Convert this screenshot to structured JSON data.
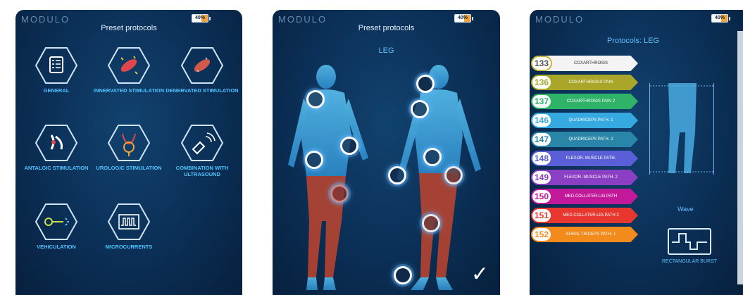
{
  "screens": [
    {
      "logo": "MODULO",
      "battery": "40%",
      "title": "Preset protocols",
      "protocols": [
        {
          "label": "GENERAL",
          "icon": "checklist-icon"
        },
        {
          "label": "INNERVATED STIMULATION",
          "icon": "innervated-muscle-icon"
        },
        {
          "label": "DENERVATED STIMULATION",
          "icon": "denervated-muscle-icon"
        },
        {
          "label": "ANTALGIC STIMULATION",
          "icon": "antalgic-joint-icon"
        },
        {
          "label": "UROLOGIC STIMULATION",
          "icon": "urologic-icon"
        },
        {
          "label": "COMBINATION WITH ULTRASOUND",
          "icon": "ultrasound-probe-icon"
        },
        {
          "label": "VEHICULATION",
          "icon": "vehiculation-icon"
        },
        {
          "label": "MICROCURRENTS",
          "icon": "microcurrent-wave-icon"
        }
      ]
    },
    {
      "logo": "MODULO",
      "battery": "40%",
      "title": "Preset protocols",
      "region": "LEG"
    },
    {
      "logo": "MODULO",
      "battery": "40%",
      "title": "Protocols: LEG",
      "items": [
        {
          "num": "133",
          "label": "COXARTHROSIS",
          "color": "#f4f4f4",
          "text": "#333"
        },
        {
          "num": "136",
          "label": "COXARTHROSIS PAIN",
          "color": "#a9a62a",
          "text": "#fff"
        },
        {
          "num": "137",
          "label": "COXARTHROSIS PAIN 2",
          "color": "#2fb368",
          "text": "#fff"
        },
        {
          "num": "146",
          "label": "QUADRICEPS PATH. 1",
          "color": "#36a9e0",
          "text": "#fff"
        },
        {
          "num": "147",
          "label": "QUADRICEPS PATH. 2",
          "color": "#2a86a8",
          "text": "#fff"
        },
        {
          "num": "148",
          "label": "FLEXOR. MUSCLE PATH.",
          "color": "#5a5fd8",
          "text": "#fff"
        },
        {
          "num": "149",
          "label": "FLEXOR. MUSCLE PATH. 2",
          "color": "#8b3fc4",
          "text": "#fff"
        },
        {
          "num": "150",
          "label": "MED.COLLATER.LIG.PATH",
          "color": "#c2189a",
          "text": "#fff"
        },
        {
          "num": "151",
          "label": "MED.COLLATER.LIG.PATH 2",
          "color": "#e8372f",
          "text": "#fff"
        },
        {
          "num": "152",
          "label": "SURAL TRICEPS PATH. 1",
          "color": "#f28a1c",
          "text": "#fff"
        }
      ],
      "wave_label": "Wave",
      "wave_name": "RECTANGULAR BURST"
    }
  ],
  "colors": {
    "accent": "#4fc3ff",
    "background": "#0b2f56",
    "muscle_highlight": "#c0452f"
  }
}
